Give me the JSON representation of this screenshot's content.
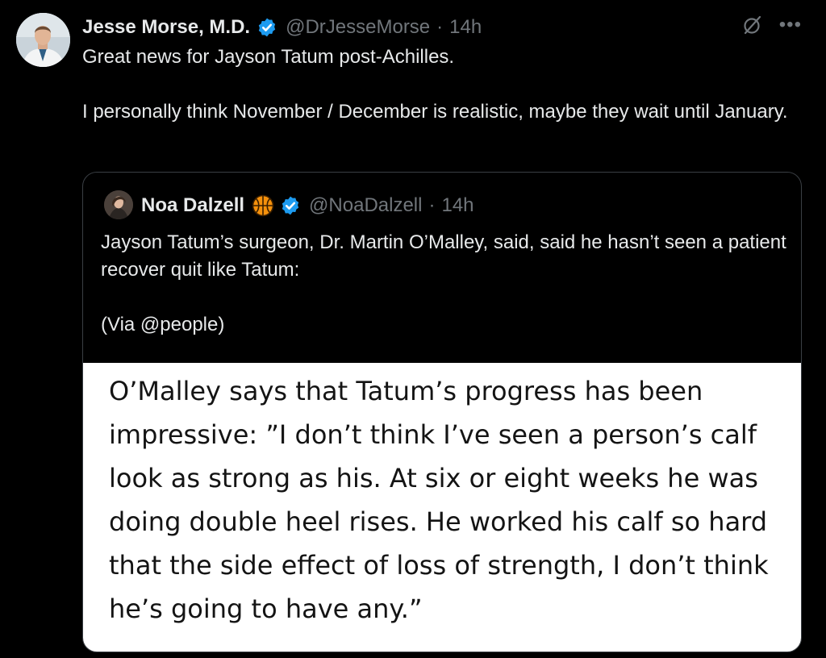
{
  "tweet": {
    "author_name": "Jesse Morse, M.D.",
    "handle": "@DrJesseMorse",
    "separator": "·",
    "time": "14h",
    "text_line1": "Great news for Jayson Tatum post-Achilles.",
    "text_line2": "I personally think November / December is realistic, maybe they wait until January."
  },
  "quote": {
    "author_name": "Noa Dalzell",
    "handle": "@NoaDalzell",
    "separator": "·",
    "time": "14h",
    "text_line1": "Jayson Tatum’s surgeon, Dr. Martin O’Malley, said, said he hasn’t seen a patient recover quit like Tatum:",
    "text_line2": "(Via @people)",
    "media_text": "O’Malley says that Tatum’s progress has been impressive: ”I don’t think I’ve seen a person’s calf look as strong as his. At six or eight weeks he was doing double heel rises. He worked his calf so hard that the side effect of loss of strength, I don’t think he’s going to have any.”"
  },
  "icons": {
    "verified": "verified-badge-icon",
    "grok": "grok-icon",
    "more": "more-options-icon",
    "basketball": "basketball-emoji-icon"
  },
  "colors": {
    "background": "#000000",
    "text": "#e7e9ea",
    "muted": "#71767b",
    "verified": "#1d9bf0",
    "border": "#3a3f44"
  }
}
